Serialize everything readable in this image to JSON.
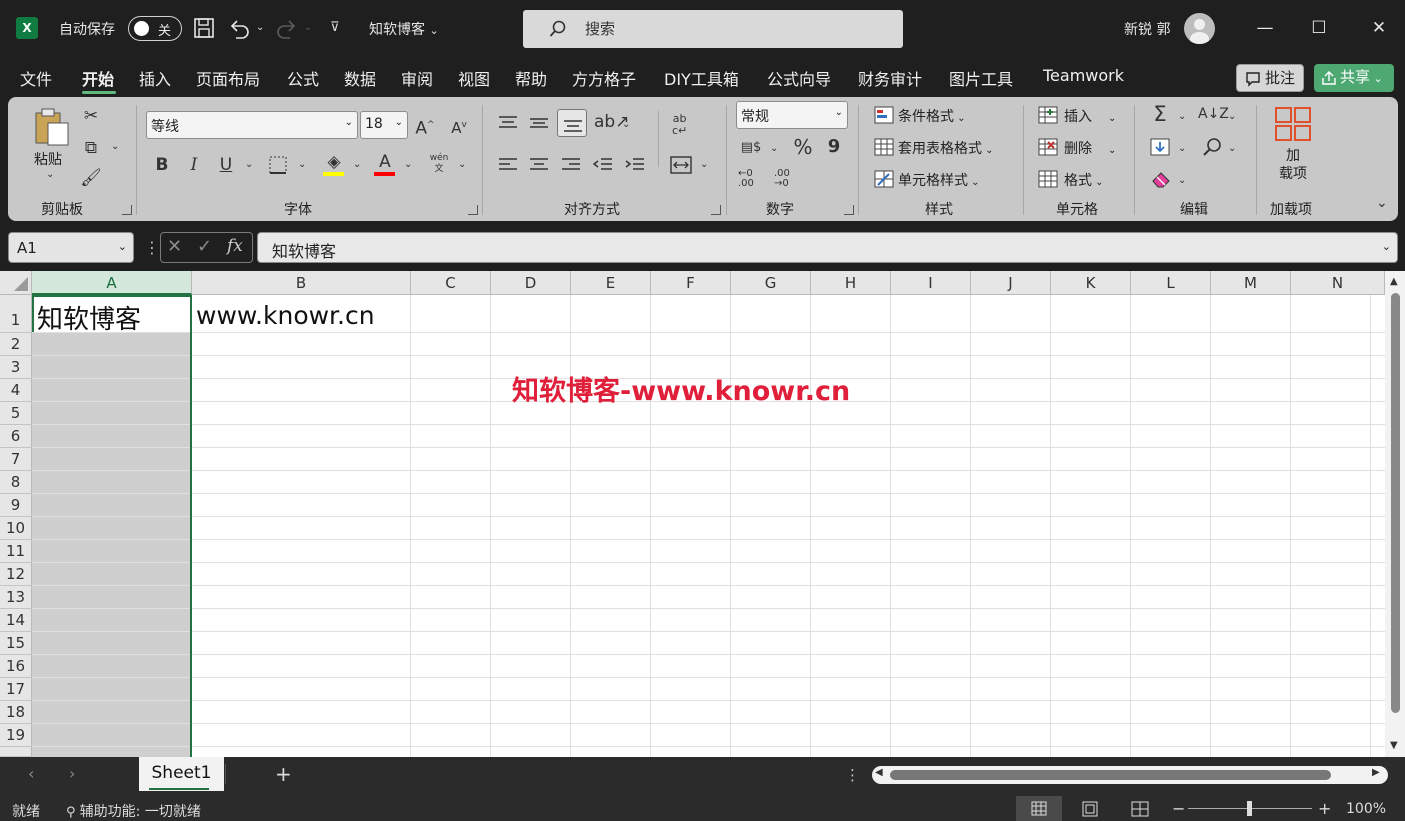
{
  "titlebar": {
    "autosave_label": "自动保存",
    "autosave_state": "关",
    "doc_title": "知软博客",
    "search_placeholder": "搜索",
    "user_name": "新锐 郭"
  },
  "menu": {
    "items": [
      "文件",
      "开始",
      "插入",
      "页面布局",
      "公式",
      "数据",
      "审阅",
      "视图",
      "帮助",
      "方方格子",
      "DIY工具箱",
      "公式向导",
      "财务审计",
      "图片工具",
      "Teamwork"
    ],
    "active": "开始",
    "comment_label": "批注",
    "share_label": "共享"
  },
  "ribbon": {
    "clipboard": {
      "paste_label": "粘贴",
      "group_label": "剪贴板"
    },
    "font": {
      "font_name": "等线",
      "font_size": "18",
      "group_label": "字体",
      "bold": "B",
      "italic": "I",
      "underline": "U",
      "grow": "A",
      "shrink": "A",
      "color_glyph": "A",
      "pinyin": "wén"
    },
    "alignment": {
      "group_label": "对齐方式"
    },
    "number": {
      "format": "常规",
      "percent": "%",
      "comma": "9",
      "group_label": "数字",
      "inc": "←0 .00",
      "dec": ".00 →0"
    },
    "styles": {
      "conditional": "条件格式",
      "table": "套用表格格式",
      "cell_styles": "单元格样式",
      "group_label": "样式"
    },
    "cells": {
      "insert": "插入",
      "delete": "删除",
      "format": "格式",
      "group_label": "单元格"
    },
    "editing": {
      "group_label": "编辑"
    },
    "addins": {
      "label": "加\n载项",
      "label1": "加",
      "label2": "载项",
      "group_label": "加载项"
    }
  },
  "formula_bar": {
    "name_box": "A1",
    "formula": "知软博客",
    "fx": "fx"
  },
  "grid": {
    "columns": [
      "A",
      "B",
      "C",
      "D",
      "E",
      "F",
      "G",
      "H",
      "I",
      "J",
      "K",
      "L",
      "M",
      "N"
    ],
    "rows": [
      "1",
      "2",
      "3",
      "4",
      "5",
      "6",
      "7",
      "8",
      "9",
      "10",
      "11",
      "12",
      "13",
      "14",
      "15",
      "16",
      "17",
      "18",
      "19"
    ],
    "A1": "知软博客",
    "B1": "www.knowr.cn",
    "watermark": "知软博客-www.knowr.cn"
  },
  "sheets": {
    "tabs": [
      "Sheet1"
    ],
    "add": "+"
  },
  "status": {
    "ready": "就绪",
    "accessibility": "辅助功能: 一切就绪",
    "zoom": "100%",
    "minus": "−",
    "plus": "+"
  }
}
